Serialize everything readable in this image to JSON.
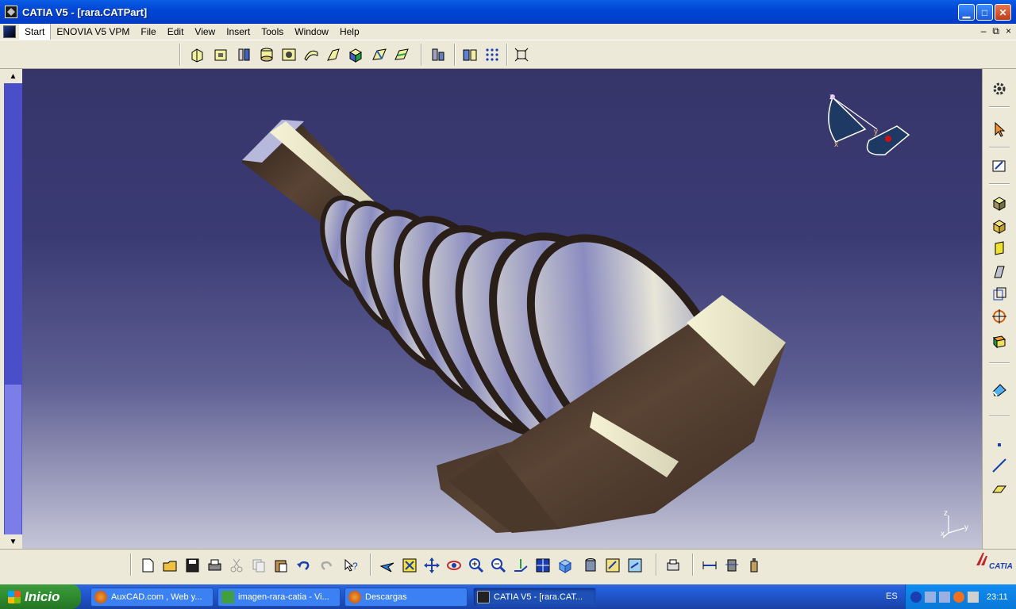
{
  "window": {
    "title": "CATIA V5 - [rara.CATPart]"
  },
  "menu": {
    "items": [
      "Start",
      "ENOVIA V5 VPM",
      "File",
      "Edit",
      "View",
      "Insert",
      "Tools",
      "Window",
      "Help"
    ],
    "mdi": [
      "–",
      "⧉",
      "×"
    ]
  },
  "compass": {
    "z_label": "z",
    "x_label": "x",
    "y_label": "y"
  },
  "axis": {
    "z": "z",
    "x": "x",
    "y": "y"
  },
  "brand": {
    "logo": "CATIA"
  },
  "taskbar": {
    "start_label": "Inicio",
    "tasks": [
      "AuxCAD.com , Web y...",
      "imagen-rara-catia - Vi...",
      "Descargas",
      "CATIA V5 - [rara.CAT..."
    ],
    "language": "ES",
    "clock": "23:11"
  },
  "colors": {
    "title": "#0046d5",
    "viewport_top": "#36356a",
    "viewport_bottom": "#c5c5d8",
    "taskbar": "#245edb",
    "start": "#2e8b2e"
  }
}
